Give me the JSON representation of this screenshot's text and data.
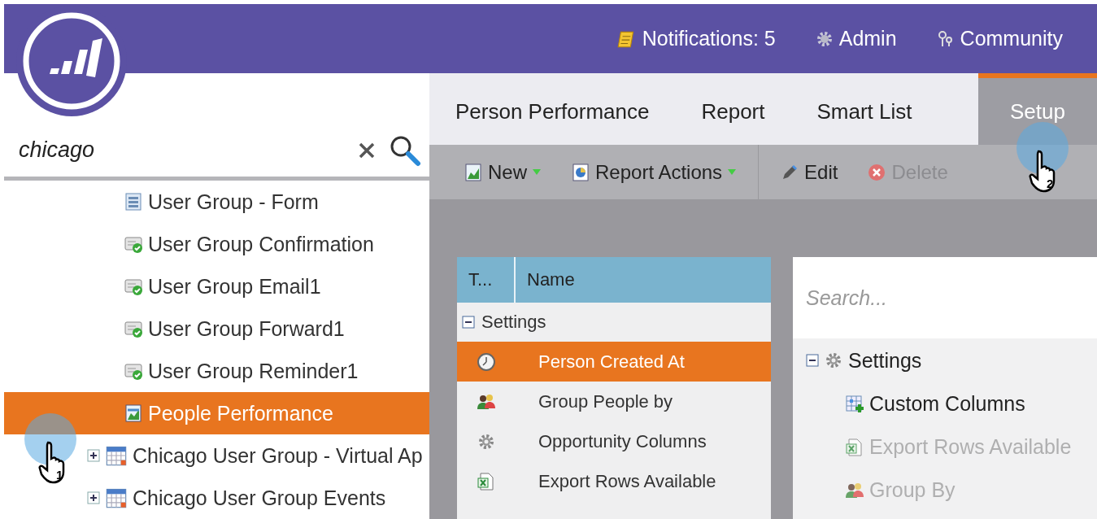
{
  "header": {
    "links": [
      {
        "kind": "notifications",
        "label": "Notifications: 5"
      },
      {
        "kind": "admin",
        "label": "Admin"
      },
      {
        "kind": "community",
        "label": "Community"
      }
    ]
  },
  "sidebar": {
    "search": {
      "value": "chicago"
    },
    "tree": {
      "continued_children": [
        {
          "kind": "form",
          "label": "User Group - Form",
          "selected": false
        },
        {
          "kind": "email",
          "label": "User Group Confirmation",
          "selected": false
        },
        {
          "kind": "email",
          "label": "User Group Email1",
          "selected": false
        },
        {
          "kind": "email",
          "label": "User Group Forward1",
          "selected": false
        },
        {
          "kind": "email",
          "label": "User Group Reminder1",
          "selected": false
        },
        {
          "kind": "report",
          "label": "People Performance",
          "selected": true
        }
      ],
      "items": [
        {
          "kind": "program",
          "label": "Chicago User Group - Virtual Ap",
          "expanded": false,
          "selected": false
        },
        {
          "kind": "program",
          "label": "Chicago User Group Events",
          "expanded": false,
          "selected": false
        }
      ]
    }
  },
  "tabs": [
    {
      "label": "Person Performance",
      "selected": false
    },
    {
      "label": "Report",
      "selected": false
    },
    {
      "label": "Smart List",
      "selected": false
    },
    {
      "label": "Setup",
      "selected": true
    }
  ],
  "toolbar": [
    {
      "kind": "new",
      "label": "New",
      "dropdown": true,
      "disabled": false
    },
    {
      "kind": "actions",
      "label": "Report Actions",
      "dropdown": true,
      "disabled": false
    },
    {
      "kind": "edit",
      "label": "Edit",
      "dropdown": false,
      "disabled": false
    },
    {
      "kind": "delete",
      "label": "Delete",
      "dropdown": false,
      "disabled": true
    }
  ],
  "table": {
    "columns": [
      "T...",
      "Name"
    ],
    "group": {
      "label": "Settings",
      "expanded": true
    },
    "rows": [
      {
        "kind": "clock",
        "name": "Person Created At",
        "selected": true
      },
      {
        "kind": "people",
        "name": "Group People by",
        "selected": false
      },
      {
        "kind": "gear",
        "name": "Opportunity Columns",
        "selected": false
      },
      {
        "kind": "excel",
        "name": "Export Rows Available",
        "selected": false
      }
    ]
  },
  "settings_panel": {
    "search": {
      "placeholder": "Search..."
    },
    "group": {
      "label": "Settings",
      "expanded": true
    },
    "items": [
      {
        "kind": "columns",
        "label": "Custom Columns",
        "disabled": false
      },
      {
        "kind": "excel",
        "label": "Export Rows Available",
        "disabled": true
      },
      {
        "kind": "people",
        "label": "Group By",
        "disabled": true
      }
    ]
  },
  "cursors": [
    {
      "label": "1"
    },
    {
      "label": "2"
    }
  ]
}
